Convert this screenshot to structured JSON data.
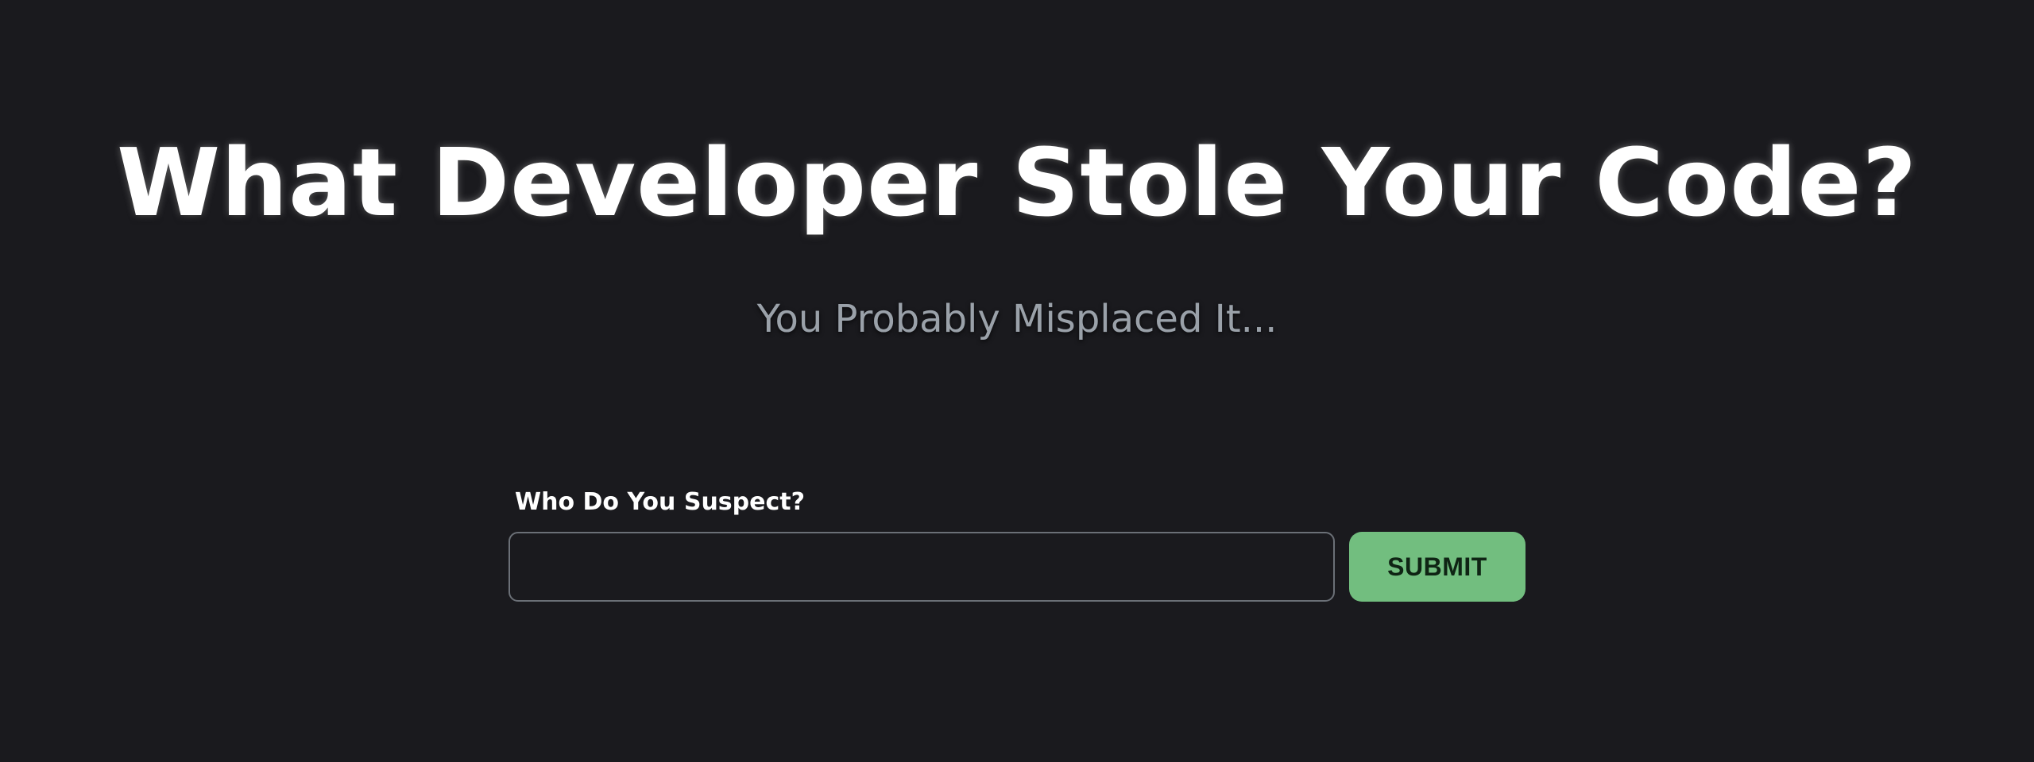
{
  "hero": {
    "title": "What Developer Stole Your Code?",
    "subtitle": "You Probably Misplaced It..."
  },
  "form": {
    "label": "Who Do You Suspect?",
    "input_value": "",
    "input_placeholder": "",
    "submit_label": "SUBMIT"
  },
  "colors": {
    "background": "#1a1a1e",
    "title": "#ffffff",
    "subtitle": "#9aa1a9",
    "input_border": "#6b7077",
    "submit_background": "#72be7f",
    "submit_text": "#0f2414"
  }
}
